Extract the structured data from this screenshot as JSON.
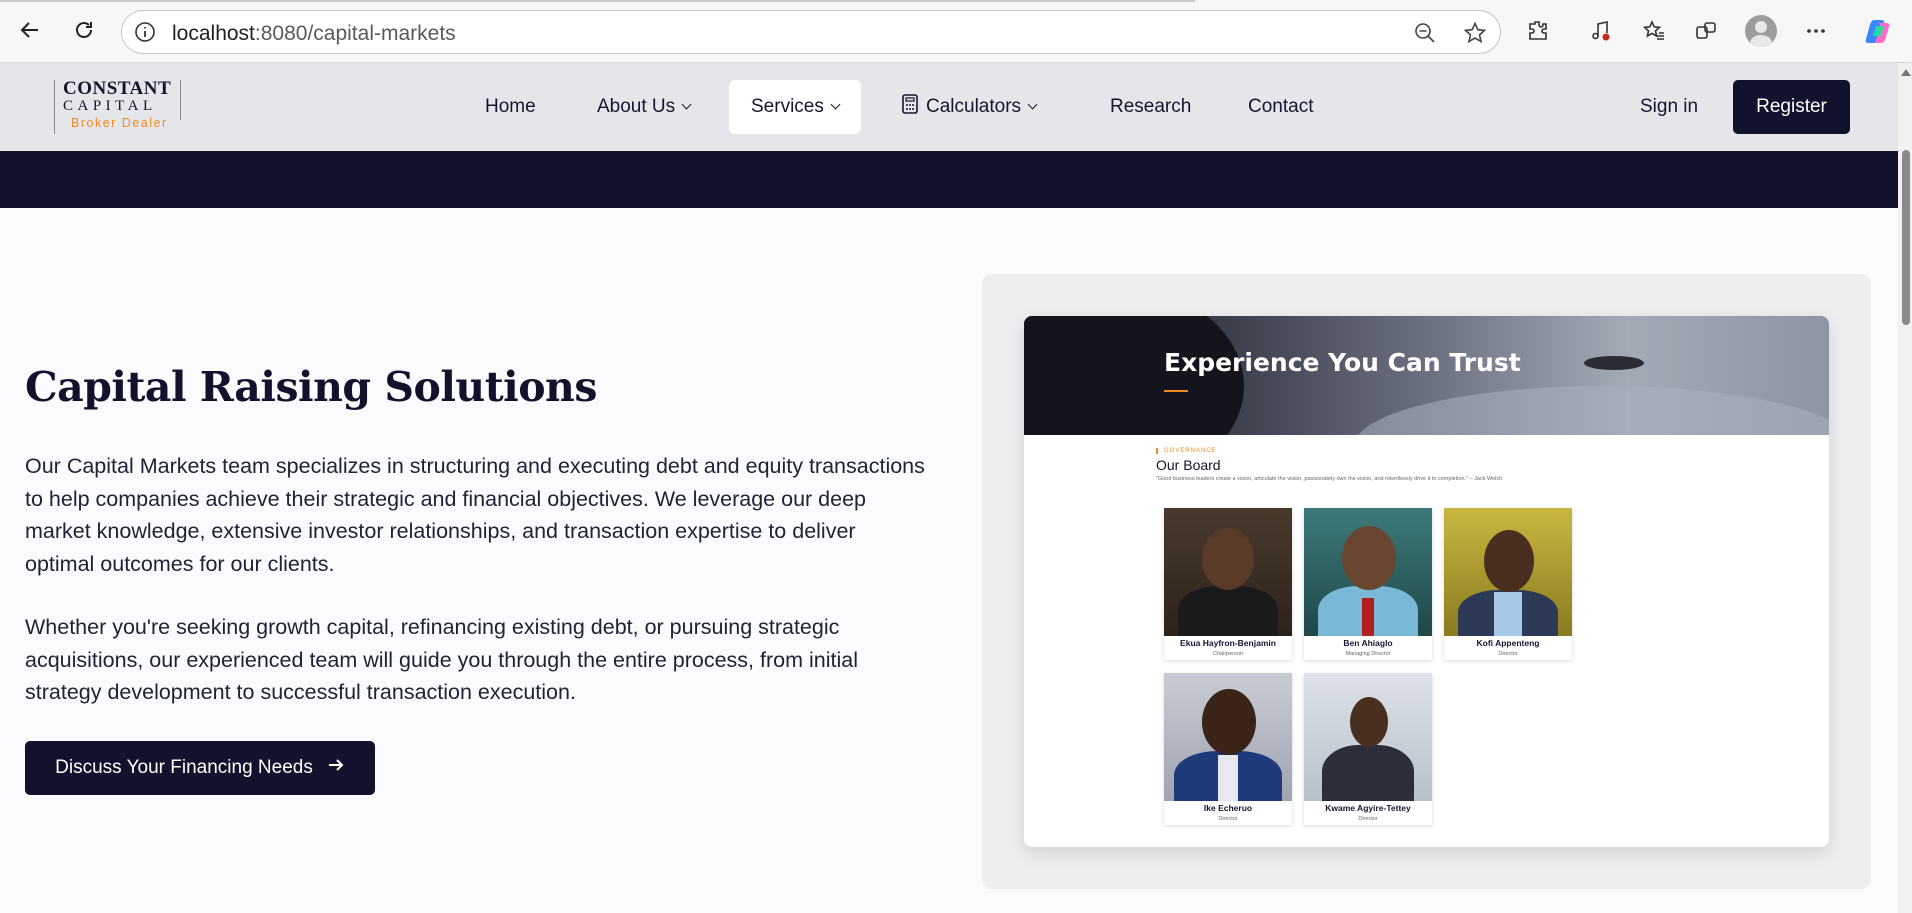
{
  "browser": {
    "url_host": "localhost",
    "url_rest": ":8080/capital-markets"
  },
  "logo": {
    "line1": "CONSTANT",
    "line2": "CAPITAL",
    "line3": "Broker Dealer"
  },
  "nav": {
    "home": "Home",
    "about": "About Us",
    "services": "Services",
    "calculators": "Calculators",
    "research": "Research",
    "contact": "Contact",
    "signin": "Sign in",
    "register": "Register"
  },
  "main": {
    "title": "Capital Raising Solutions",
    "para1": "Our Capital Markets team specializes in structuring and executing debt and equity transactions to help companies achieve their strategic and financial objectives. We leverage our deep market knowledge, extensive investor relationships, and transaction expertise to deliver optimal outcomes for our clients.",
    "para2": "Whether you're seeking growth capital, refinancing existing debt, or pursuing strategic acquisitions, our experienced team will guide you through the entire process, from initial strategy development to successful transaction execution.",
    "cta": "Discuss Your Financing Needs"
  },
  "image": {
    "banner_title": "Experience You Can Trust",
    "section_label": "GOVERNANCE",
    "board_title": "Our Board",
    "quote": "\"Good business leaders create a vision, articulate the vision, passionately own the vision, and relentlessly drive it to completion.\" – Jack Welch",
    "members": [
      {
        "name": "Ekua Hayfron-Benjamin",
        "role": "Chairperson"
      },
      {
        "name": "Ben Ahiaglo",
        "role": "Managing Director"
      },
      {
        "name": "Kofi Appenteng",
        "role": "Director"
      },
      {
        "name": "Ike Echeruo",
        "role": "Director"
      },
      {
        "name": "Kwame Agyire-Tettey",
        "role": "Director"
      }
    ]
  },
  "colors": {
    "navy": "#12122d",
    "accent": "#f08a24",
    "header_bg": "#e5e6e9"
  }
}
